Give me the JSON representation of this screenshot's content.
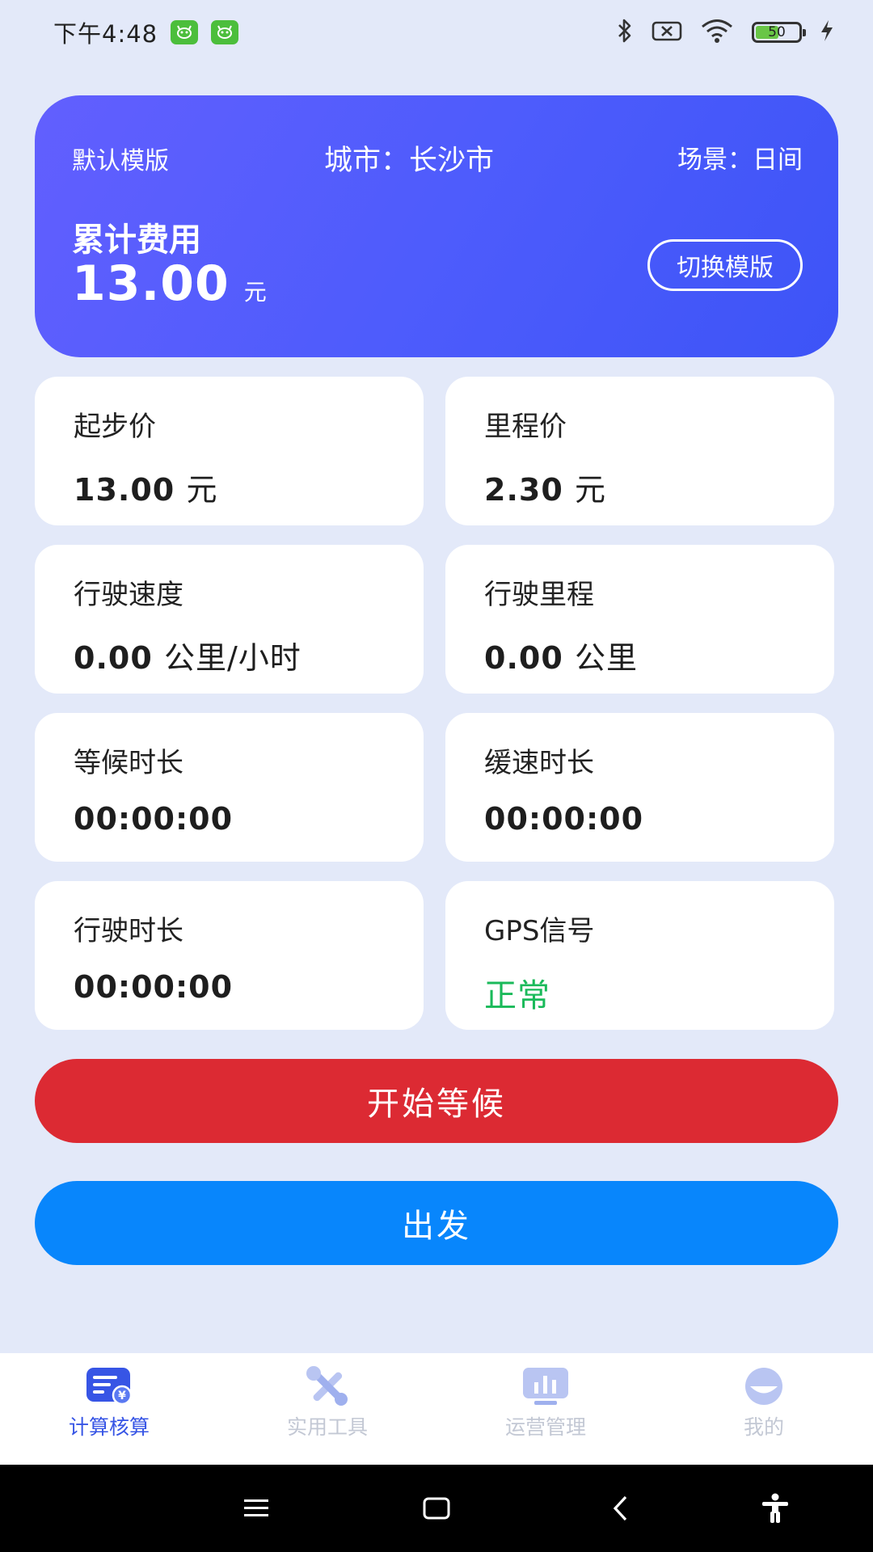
{
  "status_bar": {
    "time": "下午4:48",
    "battery_level": "50"
  },
  "hero": {
    "template_name": "默认模版",
    "city": "城市：长沙市",
    "scene": "场景：日间",
    "total_label": "累计费用",
    "total_value": "13.00",
    "total_unit": "元",
    "switch_button": "切换模版"
  },
  "cards": [
    {
      "label": "起步价",
      "value": "13.00",
      "unit": "元"
    },
    {
      "label": "里程价",
      "value": "2.30",
      "unit": "元"
    },
    {
      "label": "行驶速度",
      "value": "0.00",
      "unit": "公里/小时"
    },
    {
      "label": "行驶里程",
      "value": "0.00",
      "unit": "公里"
    },
    {
      "label": "等候时长",
      "value": "00:00:00"
    },
    {
      "label": "缓速时长",
      "value": "00:00:00"
    },
    {
      "label": "行驶时长",
      "value": "00:00:00"
    },
    {
      "label": "GPS信号",
      "value": "正常",
      "color": "#1aba5a"
    }
  ],
  "actions": {
    "wait_button": "开始等候",
    "go_button": "出发"
  },
  "tabs": [
    {
      "label": "计算核算",
      "icon": "billing-icon",
      "active": true
    },
    {
      "label": "实用工具",
      "icon": "tools-icon",
      "active": false
    },
    {
      "label": "运营管理",
      "icon": "chart-icon",
      "active": false
    },
    {
      "label": "我的",
      "icon": "profile-icon",
      "active": false
    }
  ],
  "colors": {
    "hero_gradient_start": "#625ffe",
    "hero_gradient_end": "#3d54f7",
    "wait_button": "#dc2a33",
    "go_button": "#0886fc",
    "active_tab": "#3755e5",
    "status_ok": "#1aba5a"
  }
}
